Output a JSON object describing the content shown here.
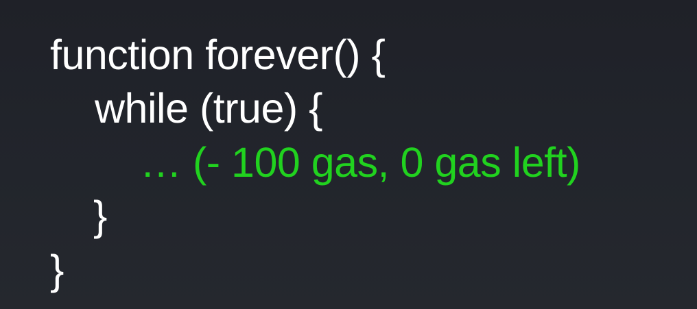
{
  "colors": {
    "background": "#22252c",
    "code_text": "#ffffff",
    "comment_text": "#21d21f"
  },
  "code": {
    "lines": [
      "function forever() {",
      "while (true) {",
      "… (- 100 gas, 0 gas left)",
      "}",
      "}"
    ]
  }
}
